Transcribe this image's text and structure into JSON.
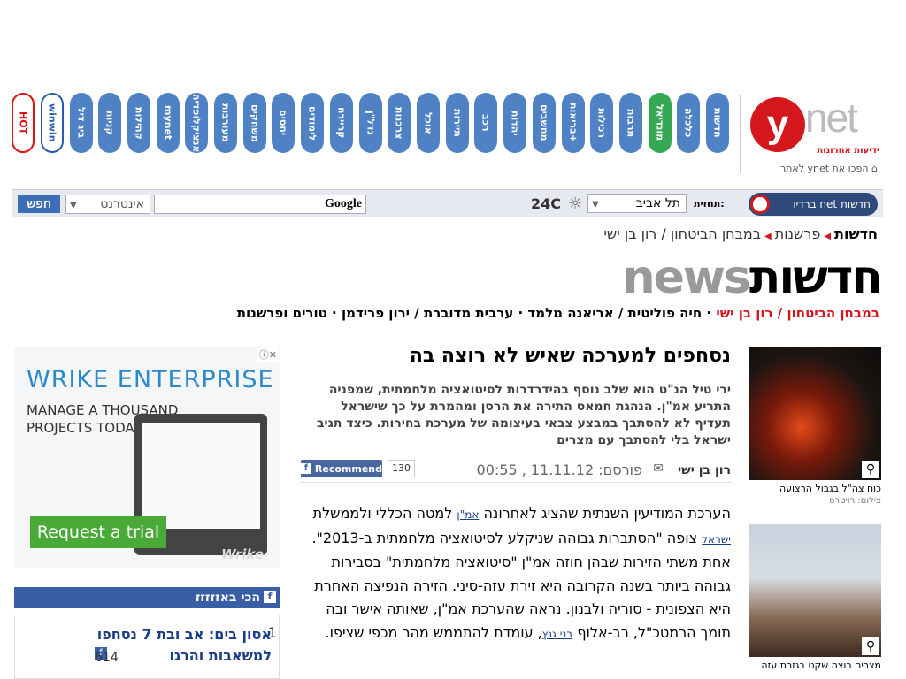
{
  "channels": [
    {
      "label": "חדשות"
    },
    {
      "label": "כלכלה"
    },
    {
      "label": "מונדיאל"
    },
    {
      "label": "תרבות"
    },
    {
      "label": "רכילות"
    },
    {
      "label": "בריאות+"
    },
    {
      "label": "מחשבים"
    },
    {
      "label": "יהדות"
    },
    {
      "label": "רכב"
    },
    {
      "label": "תיירות"
    },
    {
      "label": "אוכל"
    },
    {
      "label": "צרכנות"
    },
    {
      "label": "נדל\"ן"
    },
    {
      "label": "קריירה"
    },
    {
      "label": "לימודים"
    },
    {
      "label": "יחסים"
    },
    {
      "label": "משחקים"
    },
    {
      "label": "מעורבות"
    },
    {
      "label": "אנציקלופדיה"
    },
    {
      "label": "mynet"
    },
    {
      "label": "קהילות"
    },
    {
      "label": "קניות"
    },
    {
      "label": "ביג דיל"
    },
    {
      "label": "winwin"
    },
    {
      "label": "HOT"
    }
  ],
  "logo": {
    "y": "y",
    "net": "net",
    "sub": "ידיעות אחרונות"
  },
  "homepage_link": "הפכו את ynet לאתר",
  "toolbar": {
    "search_button": "חפש",
    "search_scope": "אינטרנט",
    "google_label": "Google",
    "temperature": "24C",
    "city": "תל אביב",
    "forecast_label": "תחזית:",
    "radio_label": "חדשות net ברדיו",
    "radio_y": "y"
  },
  "breadcrumb": {
    "root": "חדשות",
    "section": "פרשנות",
    "column": "במבחן הביטחון / רון בן ישי"
  },
  "section_title": {
    "en": "news",
    "he": "חדשות"
  },
  "subnav": {
    "active": "במבחן הביטחון / רון בן ישי",
    "items": "חיה פוליטית / אריאנה מלמד · ערבית מדוברת / ירון פרידמן · טורים ופרשנות"
  },
  "ad": {
    "title": "WRIKE ENTERPRISE",
    "subtitle": "MANAGE A THOUSAND PROJECTS TODAY",
    "cta": "Request a trial",
    "brand": "Wrike",
    "adchoices": "ⓘ✕"
  },
  "buzz": {
    "header": "הכי באזזזזז",
    "item_number": "1.",
    "item_title": "אסון בים: אב ובת 7 נסחפו למשאבות והרגו",
    "item_count": "614"
  },
  "article": {
    "headline": "נסחפים למערכה שאיש לא רוצה בה",
    "lead": "ירי טיל הנ\"ט הוא שלב נוסף בהידרדרות לסיטואציה מלחמתית, שמפניה התריע אמ\"ן. הנהגת חמאס התירה את הרסן ומהמרת על כך שישראל תעדיף לא להסתבך במבצע צבאי בעיצומה של מערכת בחירות. כיצד תגיב ישראל בלי להסתבך עם מצרים",
    "author": "רון בן ישי",
    "published": "פורסם: 11.11.12 , 00:55",
    "recommend_label": "Recommend",
    "recommend_count": "130",
    "body_1": "הערכת המודיעין השנתית שהציג לאחרונה ",
    "link_aman": "אמ\"ן",
    "body_2": " למטה הכללי ולממשלת ",
    "link_israel": "ישראל",
    "body_3": " צופה \"הסתברות גבוהה שניקלע לסיטואציה מלחמתית ב-2013\". אחת משתי הזירות שבהן חוזה אמ\"ן \"סיטואציה מלחמתית\" בסבירות גבוהה ביותר בשנה הקרובה היא זירת עזה-סיני. הזירה הנפיצה האחרת היא הצפונית - סוריה ולבנון. נראה שהערכת אמ\"ן, שאותה אישר ובה תומך הרמטכ\"ל, רב-אלוף ",
    "link_gantz": "בני גנץ",
    "body_4": ", עומדת להתממש מהר מכפי שציפו."
  },
  "photos": [
    {
      "caption": "כוח צה\"ל בגבול הרצועה",
      "credit": "צילום: רויטרס"
    },
    {
      "caption": "מצרים רוצה שקט בגזרת עזה",
      "credit": ""
    }
  ],
  "colors": {
    "accent": "#d4161d",
    "channel": "#4f82c4",
    "link": "#1a3d85"
  }
}
